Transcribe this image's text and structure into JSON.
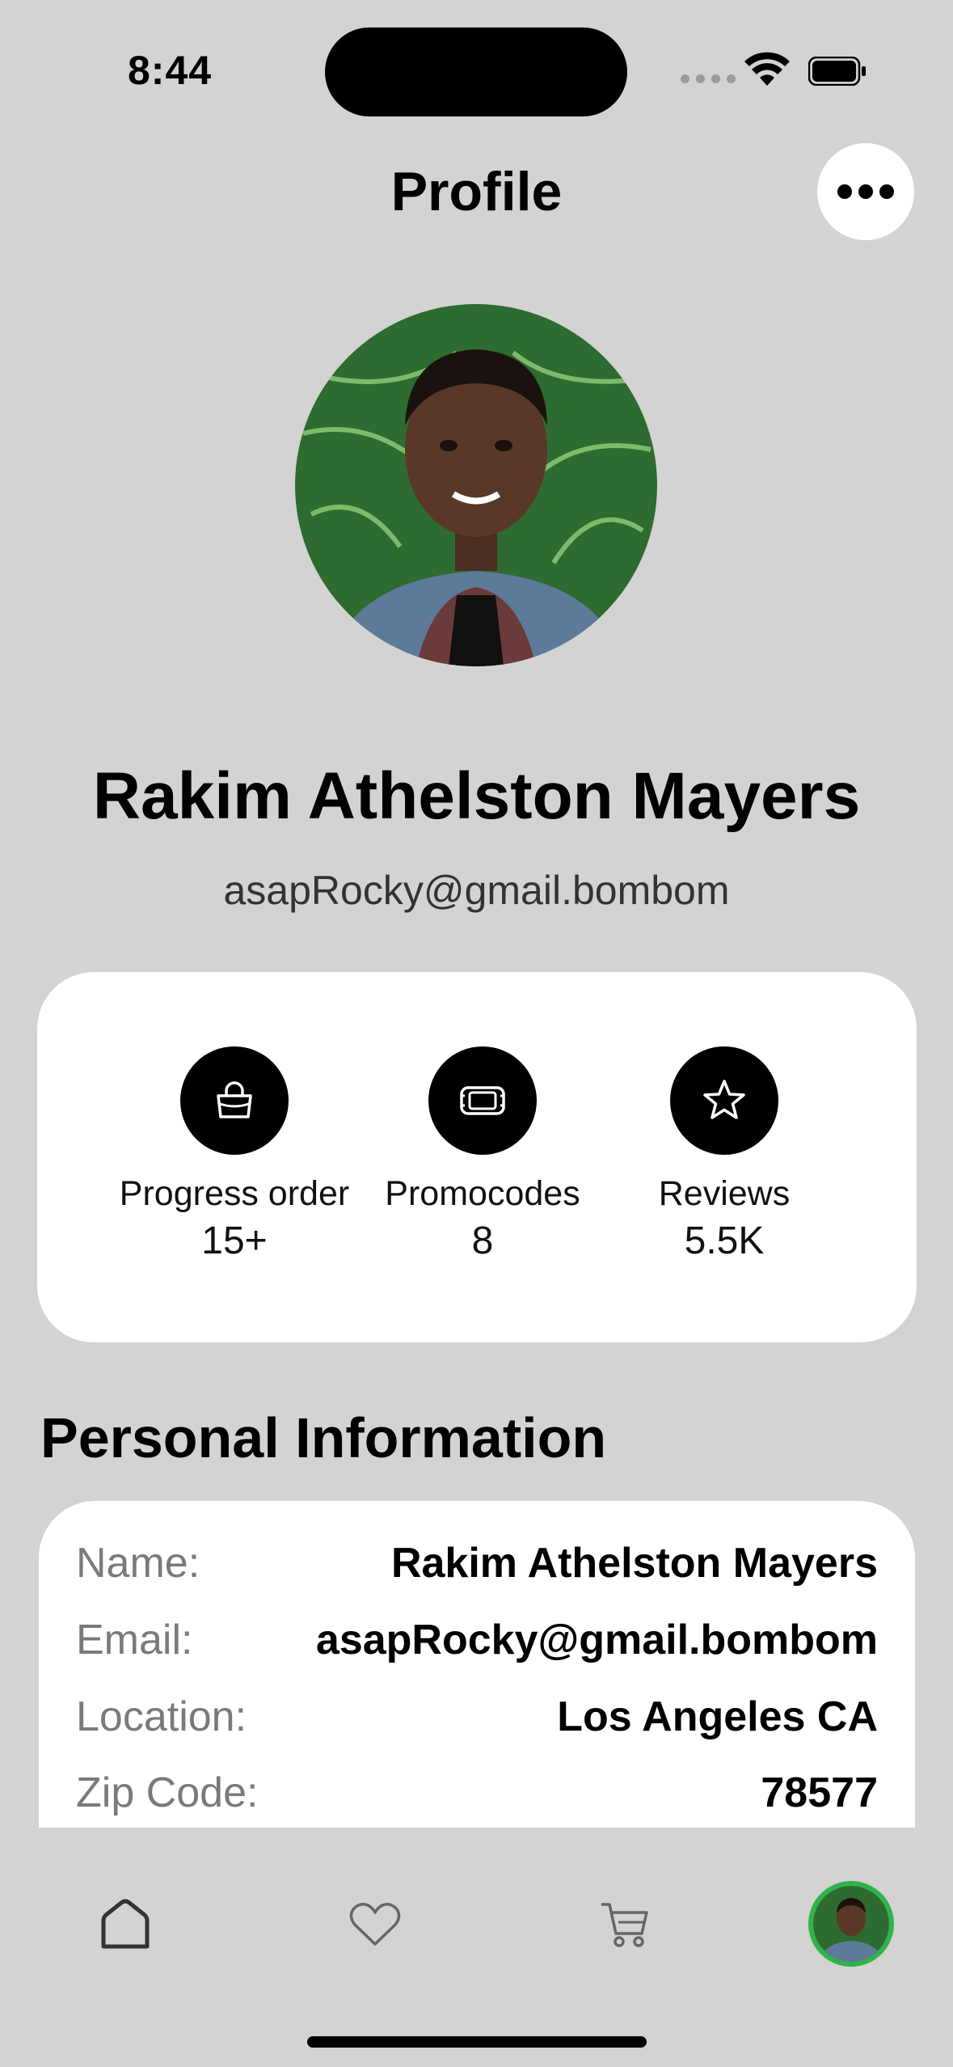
{
  "status_bar": {
    "time": "8:44"
  },
  "header": {
    "title": "Profile",
    "more_icon": "ellipsis-icon"
  },
  "profile": {
    "name": "Rakim Athelston Mayers",
    "email": "asapRocky@gmail.bombom"
  },
  "stats": [
    {
      "icon": "shopping-bag-icon",
      "label": "Progress order",
      "value": "15+"
    },
    {
      "icon": "ticket-icon",
      "label": "Promocodes",
      "value": "8"
    },
    {
      "icon": "star-icon",
      "label": "Reviews",
      "value": "5.5K"
    }
  ],
  "personal_info": {
    "title": "Personal Information",
    "rows": [
      {
        "key": "Name:",
        "value": "Rakim Athelston Mayers"
      },
      {
        "key": "Email:",
        "value": "asapRocky@gmail.bombom"
      },
      {
        "key": "Location:",
        "value": "Los Angeles CA"
      },
      {
        "key": "Zip Code:",
        "value": "78577"
      }
    ]
  },
  "tab_bar": {
    "items": [
      "home-icon",
      "heart-icon",
      "cart-icon",
      "profile-avatar"
    ],
    "active_color": "#2fb34a"
  },
  "colors": {
    "background": "#d3d3d3",
    "card": "#ffffff",
    "accent": "#000000"
  }
}
